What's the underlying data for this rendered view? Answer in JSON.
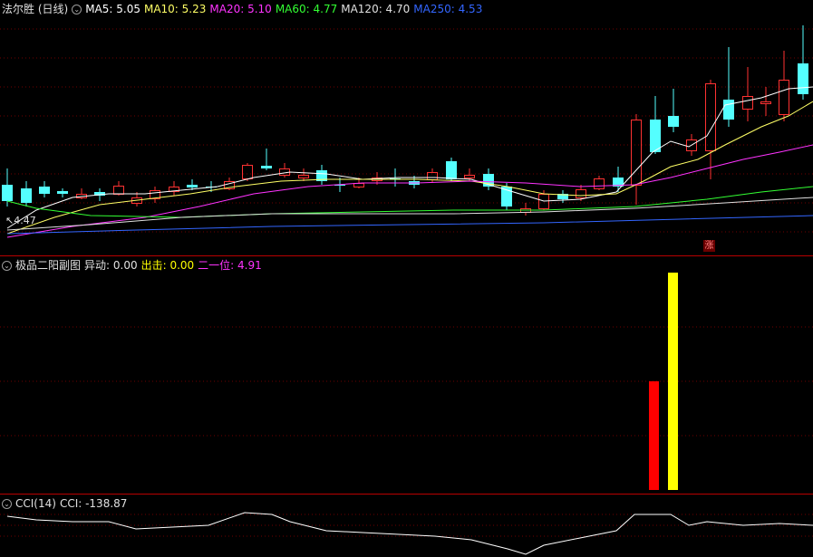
{
  "main": {
    "title": "法尔胜 (日线)",
    "ma": [
      {
        "label": "MA5: 5.05",
        "color": "#ffffff"
      },
      {
        "label": "MA10: 5.23",
        "color": "#ffff66"
      },
      {
        "label": "MA20: 5.10",
        "color": "#ff33ff"
      },
      {
        "label": "MA60: 4.77",
        "color": "#33ff33"
      },
      {
        "label": "MA120: 4.70",
        "color": "#e0e0e0"
      },
      {
        "label": "MA250: 4.53",
        "color": "#3366ff"
      }
    ],
    "last_low_label": "4.47",
    "badge": "涨",
    "up_color": "#ff3232",
    "down_color": "#54ffff"
  },
  "sub": {
    "title": "极品二阳副图",
    "items": [
      {
        "label": "异动: 0.00",
        "color": "#e0e0e0"
      },
      {
        "label": "出击: 0.00",
        "color": "#ffff00"
      },
      {
        "label": "二一位: 4.91",
        "color": "#ff33ff"
      }
    ],
    "bars": [
      {
        "name": "异动",
        "color": "#ff0000"
      },
      {
        "name": "出击",
        "color": "#ffff00"
      }
    ]
  },
  "cci": {
    "title": "CCI(14)",
    "value_label": "CCI: -138.87"
  }
}
